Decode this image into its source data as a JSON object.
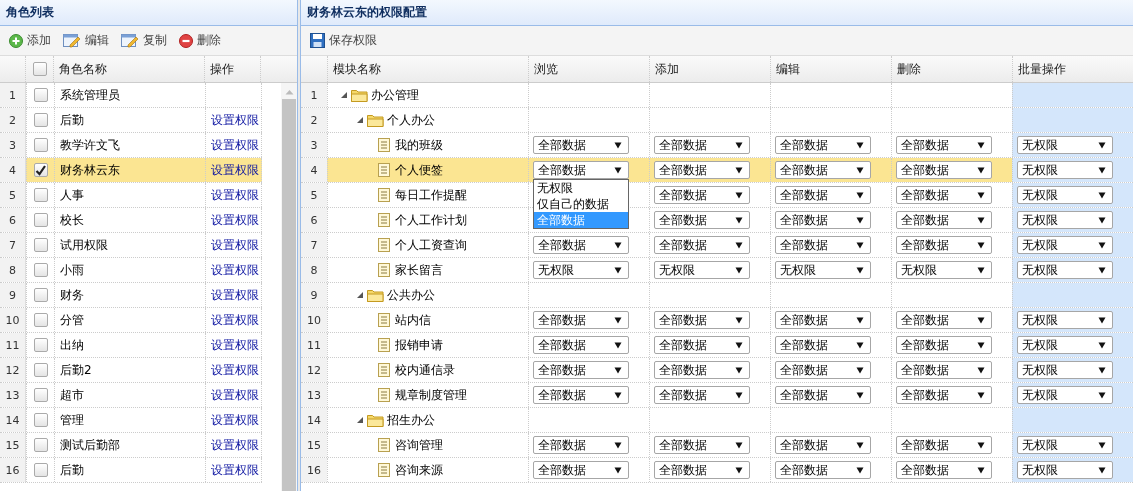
{
  "left_panel": {
    "title": "角色列表",
    "toolbar": [
      {
        "kind": "add",
        "label": "添加"
      },
      {
        "kind": "edit",
        "label": "编辑"
      },
      {
        "kind": "copy",
        "label": "复制"
      },
      {
        "kind": "delete",
        "label": "删除"
      }
    ],
    "header_checked": false,
    "columns": [
      "角色名称",
      "操作"
    ],
    "rows": [
      {
        "no": "1",
        "name": "系统管理员",
        "checked": false,
        "selected": false
      },
      {
        "no": "2",
        "name": "后勤",
        "action": "设置权限",
        "checked": false,
        "selected": false
      },
      {
        "no": "3",
        "name": "教学许文飞",
        "action": "设置权限",
        "checked": false,
        "selected": false
      },
      {
        "no": "4",
        "name": "财务林云东",
        "action": "设置权限",
        "checked": true,
        "selected": true
      },
      {
        "no": "5",
        "name": "人事",
        "action": "设置权限",
        "checked": false,
        "selected": false
      },
      {
        "no": "6",
        "name": "校长",
        "action": "设置权限",
        "checked": false,
        "selected": false
      },
      {
        "no": "7",
        "name": "试用权限",
        "action": "设置权限",
        "checked": false,
        "selected": false
      },
      {
        "no": "8",
        "name": "小雨",
        "action": "设置权限",
        "checked": false,
        "selected": false
      },
      {
        "no": "9",
        "name": "财务",
        "action": "设置权限",
        "checked": false,
        "selected": false
      },
      {
        "no": "10",
        "name": "分管",
        "action": "设置权限",
        "checked": false,
        "selected": false
      },
      {
        "no": "11",
        "name": "出纳",
        "action": "设置权限",
        "checked": false,
        "selected": false
      },
      {
        "no": "12",
        "name": "后勤2",
        "action": "设置权限",
        "checked": false,
        "selected": false
      },
      {
        "no": "13",
        "name": "超市",
        "action": "设置权限",
        "checked": false,
        "selected": false
      },
      {
        "no": "14",
        "name": "管理",
        "action": "设置权限",
        "checked": false,
        "selected": false
      },
      {
        "no": "15",
        "name": "测试后勤部",
        "action": "设置权限",
        "checked": false,
        "selected": false
      },
      {
        "no": "16",
        "name": "后勤",
        "action": "设置权限",
        "checked": false,
        "selected": false
      }
    ]
  },
  "right_panel": {
    "title": "财务林云东的权限配置",
    "toolbar": [
      {
        "kind": "save",
        "label": "保存权限"
      }
    ],
    "columns": [
      "模块名称",
      "浏览",
      "添加",
      "编辑",
      "删除",
      "批量操作"
    ],
    "tree": [
      {
        "no": "1",
        "name": "办公管理",
        "kind": "folder",
        "expanded": true,
        "selected": false,
        "children": [
          {
            "no": "2",
            "name": "个人办公",
            "kind": "folder",
            "expanded": true,
            "selected": false,
            "children": [
              {
                "no": "3",
                "name": "我的班级",
                "kind": "page",
                "selected": false,
                "cells": [
                  "全部数据",
                  "全部数据",
                  "全部数据",
                  "全部数据",
                  "无权限"
                ]
              },
              {
                "no": "4",
                "name": "个人便签",
                "kind": "page",
                "selected": true,
                "cells": [
                  {
                    "value": "全部数据",
                    "open": true,
                    "options": [
                      {
                        "label": "无权限",
                        "selected": false
                      },
                      {
                        "label": "仅自己的数据",
                        "selected": false
                      },
                      {
                        "label": "全部数据",
                        "selected": true
                      }
                    ]
                  },
                  "全部数据",
                  "全部数据",
                  "全部数据",
                  "无权限"
                ]
              },
              {
                "no": "5",
                "name": "每日工作提醒",
                "kind": "page",
                "selected": false,
                "cells": [
                  null,
                  "全部数据",
                  "全部数据",
                  "全部数据",
                  "无权限"
                ]
              },
              {
                "no": "6",
                "name": "个人工作计划",
                "kind": "page",
                "selected": false,
                "cells": [
                  null,
                  "全部数据",
                  "全部数据",
                  "全部数据",
                  "无权限"
                ]
              },
              {
                "no": "7",
                "name": "个人工资查询",
                "kind": "page",
                "selected": false,
                "cells": [
                  "全部数据",
                  "全部数据",
                  "全部数据",
                  "全部数据",
                  "无权限"
                ]
              },
              {
                "no": "8",
                "name": "家长留言",
                "kind": "page",
                "selected": false,
                "cells": [
                  "无权限",
                  "无权限",
                  "无权限",
                  "无权限",
                  "无权限"
                ]
              }
            ]
          },
          {
            "no": "9",
            "name": "公共办公",
            "kind": "folder",
            "expanded": true,
            "selected": false,
            "children": [
              {
                "no": "10",
                "name": "站内信",
                "kind": "page",
                "selected": false,
                "cells": [
                  "全部数据",
                  "全部数据",
                  "全部数据",
                  "全部数据",
                  "无权限"
                ]
              },
              {
                "no": "11",
                "name": "报销申请",
                "kind": "page",
                "selected": false,
                "cells": [
                  "全部数据",
                  "全部数据",
                  "全部数据",
                  "全部数据",
                  "无权限"
                ]
              },
              {
                "no": "12",
                "name": "校内通信录",
                "kind": "page",
                "selected": false,
                "cells": [
                  "全部数据",
                  "全部数据",
                  "全部数据",
                  "全部数据",
                  "无权限"
                ]
              },
              {
                "no": "13",
                "name": "规章制度管理",
                "kind": "page",
                "selected": false,
                "cells": [
                  "全部数据",
                  "全部数据",
                  "全部数据",
                  "全部数据",
                  "无权限"
                ]
              }
            ]
          },
          {
            "no": "14",
            "name": "招生办公",
            "kind": "folder",
            "expanded": true,
            "selected": false,
            "children": [
              {
                "no": "15",
                "name": "咨询管理",
                "kind": "page",
                "selected": false,
                "cells": [
                  "全部数据",
                  "全部数据",
                  "全部数据",
                  "全部数据",
                  "无权限"
                ]
              },
              {
                "no": "16",
                "name": "咨询来源",
                "kind": "page",
                "selected": false,
                "cells": [
                  "全部数据",
                  "全部数据",
                  "全部数据",
                  "全部数据",
                  "无权限"
                ]
              }
            ]
          }
        ]
      }
    ]
  }
}
